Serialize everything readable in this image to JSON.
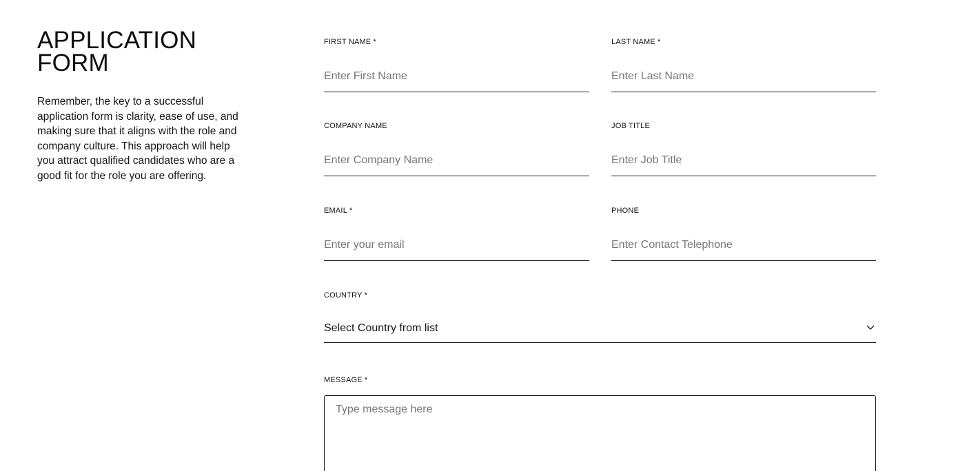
{
  "intro": {
    "title_line1": "APPLICATION",
    "title_line2": "FORM",
    "description": "Remember, the key to a successful application form is clarity, ease of use, and making sure that it aligns with the role and company culture. This approach will help you attract qualified candidates who are a good fit for the role you are offering."
  },
  "form": {
    "first_name": {
      "label": "FIRST NAME",
      "required": "*",
      "placeholder": "Enter First Name",
      "value": ""
    },
    "last_name": {
      "label": "LAST NAME",
      "required": "*",
      "placeholder": "Enter Last Name",
      "value": ""
    },
    "company_name": {
      "label": "COMPANY NAME",
      "placeholder": "Enter Company Name",
      "value": ""
    },
    "job_title": {
      "label": "JOB TITLE",
      "placeholder": "Enter Job Title",
      "value": ""
    },
    "email": {
      "label": "EMAIL",
      "required": "*",
      "placeholder": "Enter your email",
      "value": ""
    },
    "phone": {
      "label": "PHONE",
      "placeholder": "Enter Contact Telephone",
      "value": ""
    },
    "country": {
      "label": "COUNTRY",
      "required": "*",
      "selected": "Select Country from list",
      "icon": "chevron-down-icon"
    },
    "message": {
      "label": "MESSAGE",
      "required": "*",
      "placeholder": "Type message here",
      "value": ""
    }
  },
  "colors": {
    "text": "#111111",
    "placeholder": "#777777",
    "border": "#1a1a1a",
    "background": "#ffffff"
  }
}
